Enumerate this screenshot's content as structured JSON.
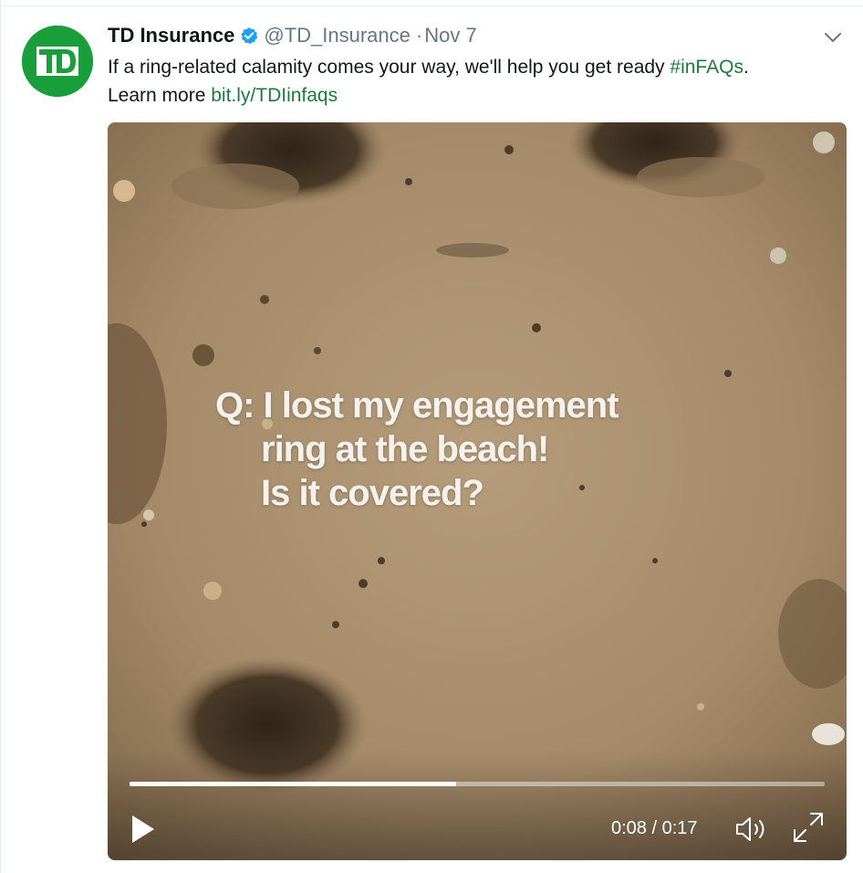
{
  "tweet": {
    "display_name": "TD Insurance",
    "handle": "@TD_Insurance",
    "separator": "·",
    "date": "Nov 7",
    "avatar_text": "TD",
    "text_before": "If a ring-related calamity comes your way, we'll help you get ready ",
    "hashtag": "#inFAQs",
    "text_after": ".",
    "learn_more": "Learn more ",
    "link": "bit.ly/TDIinfaqs"
  },
  "video": {
    "overlay_line1": "Q: I lost my engagement",
    "overlay_line2": "ring at the beach!",
    "overlay_line3": "Is it covered?",
    "current_time": "0:08",
    "duration": "0:17",
    "time_display": "0:08 / 0:17",
    "progress": 0.47
  },
  "icons": {
    "verified": "verified-badge-icon",
    "caret": "chevron-down-icon",
    "play": "play-icon",
    "volume": "volume-icon",
    "fullscreen": "fullscreen-icon"
  },
  "colors": {
    "brand_green": "#1a9d3b",
    "link_green": "#1b7c3b",
    "verified_blue": "#1da1f2",
    "secondary_text": "#657786"
  }
}
